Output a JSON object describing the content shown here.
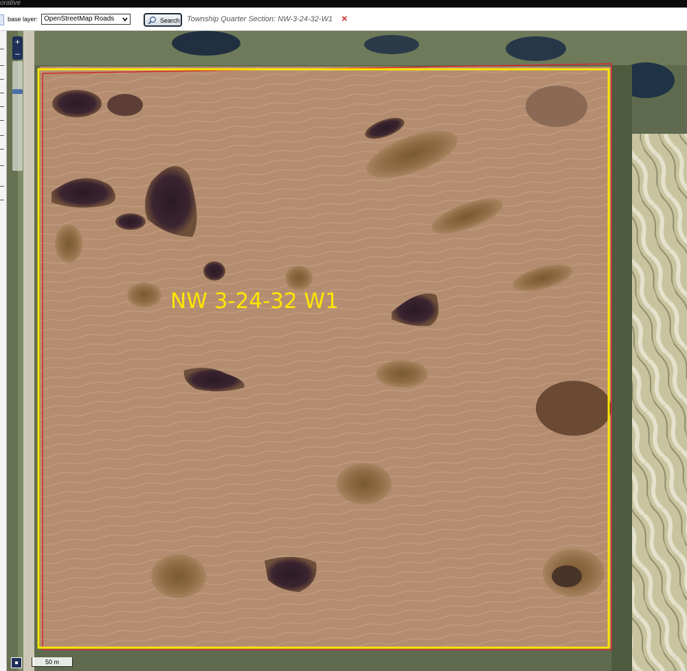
{
  "app": {
    "title_fragment": "orative"
  },
  "toolbar": {
    "base_layer_label": "base layer:",
    "base_layer_value": "OpenStreetMap Roads",
    "search_label": "Search",
    "result_text": "Township Quarter Section: NW-3-24-32-W1",
    "clear_icon": "×"
  },
  "map": {
    "zoom_in": "+",
    "zoom_out": "–",
    "zoom_level_fraction": 0.27,
    "parcel_label": "NW 3-24-32 W1",
    "scale_label": "50 m",
    "colors": {
      "parcel_outline": "#ffe600",
      "boundary_outline": "#d42a2a",
      "label": "#ffe600"
    }
  },
  "icons": {
    "search": "magnifier-icon",
    "clear": "close-icon",
    "dropdown": "chevron-down-icon"
  }
}
